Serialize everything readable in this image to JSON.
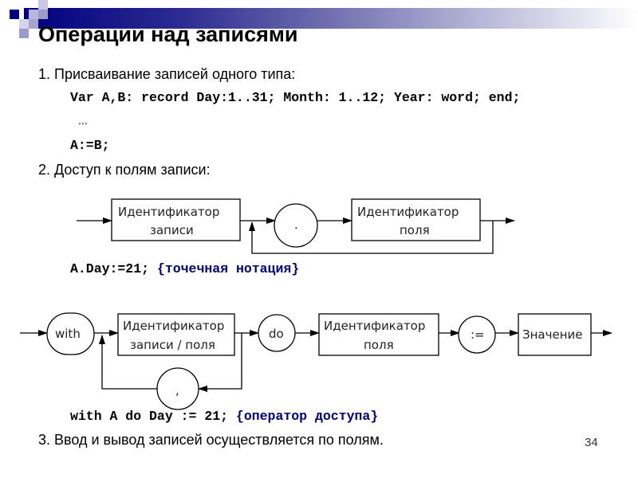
{
  "slide": {
    "title": "Операции над записями",
    "page_number": "34",
    "colors": {
      "accent": "#000080",
      "comment": "#00007a"
    }
  },
  "content": {
    "item1": "1. Присваивание записей одного типа:",
    "code1": "Var A,B: record Day:1..31; Month: 1..12; Year: word; end;",
    "ellipsis": "...",
    "code2": "A:=B;",
    "item2": "2. Доступ к полям записи:",
    "code3": "A.Day:=21;",
    "code3_comment": "{точечная нотация}",
    "code4": "with A do Day := 21;",
    "code4_comment": "{оператор доступа}",
    "item3": "3. Ввод и вывод записей осуществляется по полям."
  },
  "diagram1": {
    "box1": [
      "Идентификатор",
      "записи"
    ],
    "circle": ".",
    "box2": [
      "Идентификатор",
      "поля"
    ]
  },
  "diagram2": {
    "with": "with",
    "box1": [
      "Идентификатор",
      "записи / поля"
    ],
    "do": "do",
    "box2": [
      "Идентификатор",
      "поля"
    ],
    "assign": ":=",
    "value": "Значение",
    "comma": ","
  }
}
